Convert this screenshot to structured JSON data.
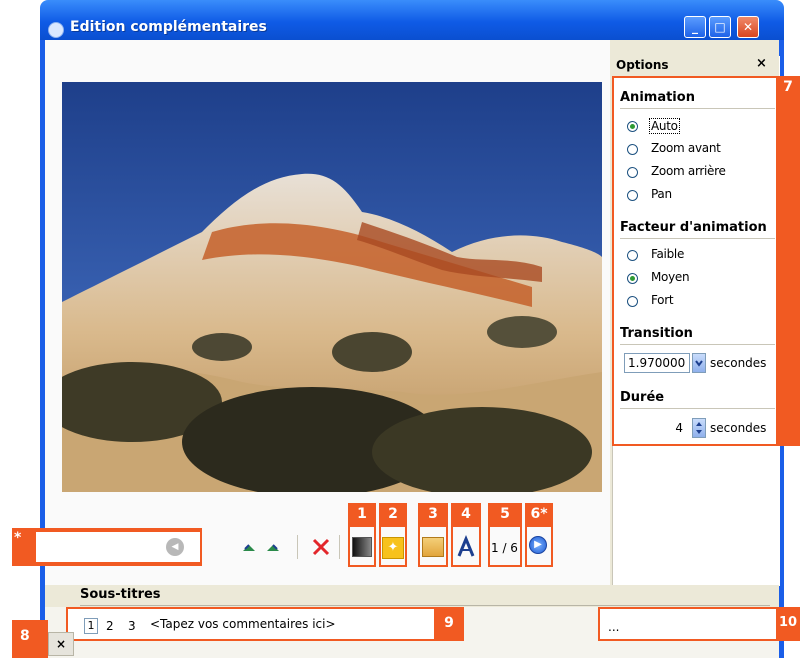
{
  "window": {
    "title": "Edition complémentaires",
    "controls": [
      "minimize",
      "maximize",
      "close"
    ]
  },
  "options_panel": {
    "title": "Options",
    "close_label": "×",
    "animation": {
      "heading": "Animation",
      "options": [
        "Auto",
        "Zoom avant",
        "Zoom arrière",
        "Pan"
      ],
      "selected": "Auto"
    },
    "factor": {
      "heading": "Facteur d'animation",
      "options": [
        "Faible",
        "Moyen",
        "Fort"
      ],
      "selected": "Moyen"
    },
    "transition": {
      "heading": "Transition",
      "value": "1.970000",
      "unit": "secondes"
    },
    "duration": {
      "heading": "Durée",
      "value": "4",
      "unit": "secondes"
    }
  },
  "toolbar": {
    "page_counter": "1 / 6",
    "icons": [
      "rotate-left-icon",
      "rotate-right-icon",
      "delete-icon",
      "color-icon",
      "effects-icon",
      "crop-icon",
      "text-icon",
      "next-icon"
    ]
  },
  "annotations": {
    "labels": [
      "1",
      "2",
      "3",
      "4",
      "5",
      "6*",
      "7",
      "8",
      "9",
      "10",
      "*"
    ]
  },
  "subtitles": {
    "heading": "Sous-titres",
    "tabs": [
      "1",
      "2",
      "3"
    ],
    "comment_placeholder": "<Tapez vos commentaires ici>",
    "ellipsis": "...",
    "close_label": "×"
  },
  "colors": {
    "accent": "#f15a22",
    "titlebar": "#0f5be6",
    "window_bg": "#ece9d8"
  }
}
